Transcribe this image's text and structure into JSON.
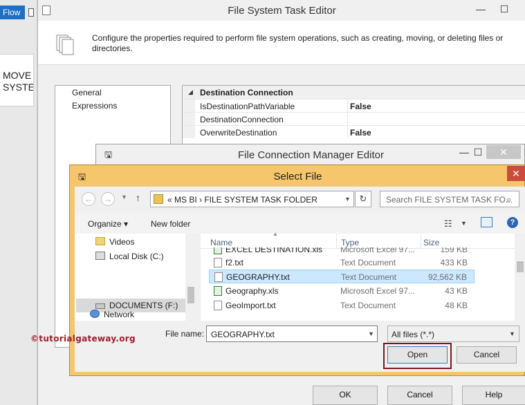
{
  "background_app": {
    "flow_tab": "Flow",
    "task_box_line1": "MOVE I",
    "task_box_line2": "SYSTEN"
  },
  "file_system_task_editor": {
    "title": "File System Task Editor",
    "description": "Configure the properties required to perform file system operations, such as creating, moving, or deleting files or directories.",
    "nav": [
      "General",
      "Expressions"
    ],
    "property_category": "Destination Connection",
    "properties": [
      {
        "name": "IsDestinationPathVariable",
        "value": "False"
      },
      {
        "name": "DestinationConnection",
        "value": ""
      },
      {
        "name": "OverwriteDestination",
        "value": "False"
      }
    ],
    "buttons": {
      "ok": "OK",
      "cancel": "Cancel",
      "help": "Help"
    }
  },
  "file_connection_manager_editor": {
    "title": "File Connection Manager Editor"
  },
  "select_file": {
    "title": "Select File",
    "address_path": "«  MS BI  ›  FILE SYSTEM TASK FOLDER",
    "search_placeholder": "Search FILE SYSTEM TASK FO...",
    "toolbar": {
      "organize": "Organize ▾",
      "new_folder": "New folder"
    },
    "tree": [
      {
        "label": "Videos",
        "icon": "folder-icon"
      },
      {
        "label": "Local Disk (C:)",
        "icon": "drive-icon"
      },
      {
        "label": "DOCUMENTS (F:)",
        "icon": "drive-icon",
        "selected": true
      },
      {
        "label": "Network",
        "icon": "network-icon"
      }
    ],
    "columns": {
      "name": "Name",
      "type": "Type",
      "size": "Size"
    },
    "files": [
      {
        "name": "EXCEL DESTINATION.xls",
        "type": "Microsoft Excel 97...",
        "size": "159 KB",
        "icon": "excel-file-icon"
      },
      {
        "name": "f2.txt",
        "type": "Text Document",
        "size": "433 KB",
        "icon": "text-file-icon"
      },
      {
        "name": "GEOGRAPHY.txt",
        "type": "Text Document",
        "size": "92,562 KB",
        "icon": "text-file-icon",
        "selected": true
      },
      {
        "name": "Geography.xls",
        "type": "Microsoft Excel 97...",
        "size": "43 KB",
        "icon": "excel-file-icon"
      },
      {
        "name": "GeoImport.txt",
        "type": "Text Document",
        "size": "48 KB",
        "icon": "text-file-icon"
      }
    ],
    "file_name_label": "File name:",
    "file_name_value": "GEOGRAPHY.txt",
    "filter_value": "All files (*.*)",
    "open_label": "Open",
    "cancel_label": "Cancel"
  },
  "watermark": "©tutorialgateway.org",
  "colors": {
    "dialog_frame": "#f5c66b",
    "selection": "#cce8ff",
    "open_highlight": "#7a1525",
    "watermark": "#a11d2c"
  }
}
